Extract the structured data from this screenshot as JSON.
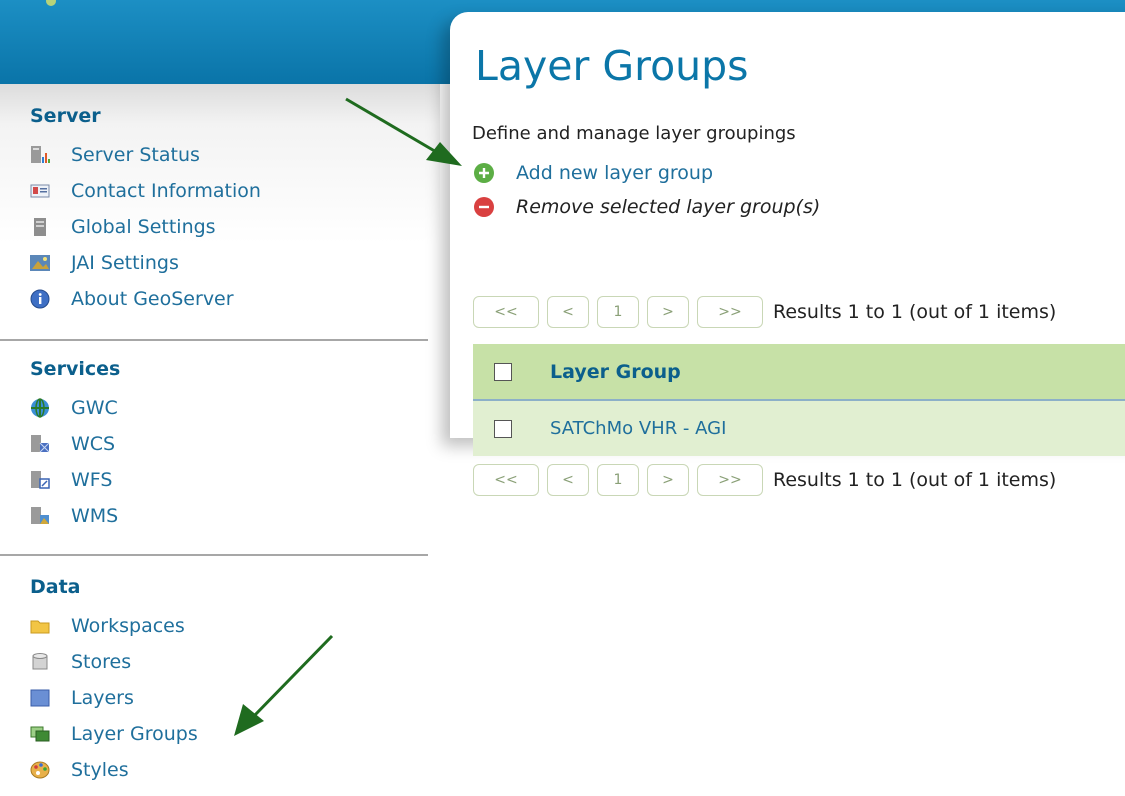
{
  "sidebar": {
    "server": {
      "title": "Server",
      "items": [
        {
          "label": "Server Status",
          "icon": "server-status-icon"
        },
        {
          "label": "Contact Information",
          "icon": "contact-card-icon"
        },
        {
          "label": "Global Settings",
          "icon": "settings-doc-icon"
        },
        {
          "label": "JAI Settings",
          "icon": "jai-image-icon"
        },
        {
          "label": "About GeoServer",
          "icon": "info-icon"
        }
      ]
    },
    "services": {
      "title": "Services",
      "items": [
        {
          "label": "GWC",
          "icon": "globe-icon"
        },
        {
          "label": "WCS",
          "icon": "wcs-server-icon"
        },
        {
          "label": "WFS",
          "icon": "wfs-server-icon"
        },
        {
          "label": "WMS",
          "icon": "wms-server-icon"
        }
      ]
    },
    "data": {
      "title": "Data",
      "items": [
        {
          "label": "Workspaces",
          "icon": "folder-icon"
        },
        {
          "label": "Stores",
          "icon": "database-icon"
        },
        {
          "label": "Layers",
          "icon": "layer-icon"
        },
        {
          "label": "Layer Groups",
          "icon": "layer-groups-icon"
        },
        {
          "label": "Styles",
          "icon": "palette-icon"
        }
      ]
    }
  },
  "main": {
    "title": "Layer Groups",
    "description": "Define and manage layer groupings",
    "add_label": "Add new layer group",
    "remove_label": "Remove selected layer group(s)",
    "pager": {
      "first": "<<",
      "prev": "<",
      "page": "1",
      "next": ">",
      "last": ">>",
      "results": "Results 1 to 1 (out of 1 items)"
    },
    "table": {
      "header": "Layer Group",
      "rows": [
        {
          "name": "SATChMo VHR - AGI"
        }
      ]
    }
  },
  "colors": {
    "header_blue": "#0a74a8",
    "link_blue": "#1f6f9c",
    "table_header_green": "#c7e1a7",
    "table_row_green": "#e1efd1",
    "add_green": "#5cae45",
    "remove_red": "#d94040",
    "arrow_green": "#1f6b1f"
  }
}
